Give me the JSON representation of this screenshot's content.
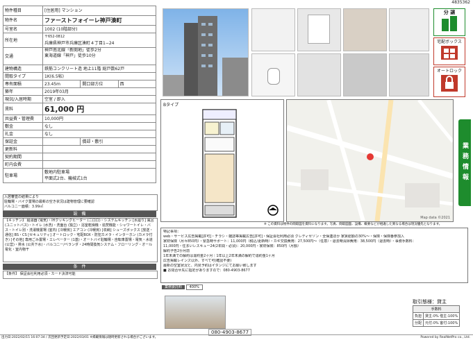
{
  "doc_id": "4835362",
  "spec": {
    "type_label": "物件種目",
    "type_value": "[住居用] マンション",
    "name_label": "物件名",
    "name_value": "ファーストフォイーレ神戸湊町",
    "room_label": "号室名",
    "room_value": "1002 (10階部分)",
    "address_label": "所在地",
    "postal": "〒652-0812",
    "address_value": "兵庫県神戸市兵庫区湊町４丁目1−24",
    "access_label": "交通",
    "access_1": "神戸南北線「新開地」徒歩2分",
    "access_2": "東海道線「神戸」徒歩10分",
    "structure_label": "建物構造",
    "structure_value": "鉄筋コンクリート造 地上11階 総戸数62戸",
    "layout_label": "間取タイプ",
    "layout_value": "1K(6.5帖)",
    "area_label": "専有面積",
    "area_value": "23.45m",
    "window_label": "開口部方位",
    "window_value": "西",
    "built_label": "築年",
    "built_value": "2019年03月",
    "status_label": "現況/入居時期",
    "status_value": "空室 / 即入",
    "rent_label": "賃料",
    "rent_value": "61,000 円",
    "common_label": "共益費・管理費",
    "common_value": "10,000円",
    "deposit_label": "敷金",
    "deposit_value": "なし",
    "key_label": "礼金",
    "key_value": "なし",
    "guarantee_label": "保証金",
    "guarantee_value": "償却・敷引",
    "renewal_label": "更新料",
    "contract_label": "契約期間",
    "assoc_label": "町内会費",
    "parking_label": "駐車場",
    "parking_1": "敷地内駐車場",
    "parking_2": "平面式2台、機械式1台",
    "notes_1": "入居審査の結果により",
    "notes_2": "駐輪場・バイク置場の最新の空き状況は建物管理に要確認",
    "notes_3": "バルコニー面積：3.99㎡",
    "facility_head": "設　備",
    "facility_text": "【キッチン】 給湯器 (電気)・IHクッキングヒーター (二口口)・システムキッチン [水廻り] 風呂 (ユニットバス)・トイレ (水洗)・洗面台 (独立)・浴室乾燥機・追焚機能・シャワートイレ・バス・トイレ別・洗濯機置場 (室内) [冷暖房] エアコン (冷暖房) [収納] シューズボックス [放送・通信] BS・CS [セキュリティ] オートロック・宅配BOX・防犯カメラ・インターホン (カメラ付き) [その他] 専用ごみ置場・エレベーター (1基)・オートバイ駐輪場・自転車置場・電気・水道 (公営)・排水 (公共下水)・バルコニー/ベランダ・24時間換気システム・フローリング・オール電化・室内物干",
    "cond_head": "条　件",
    "cond_text": "【条件】 保証会社利用必須・カード決済可能"
  },
  "floorplan": {
    "type_label": "Bタイプ"
  },
  "map": {
    "footer": "Map data ©2021"
  },
  "caption": "※ この資料は物件の間取図を資料になります。写真、間取図面、設備、概要などが相違した異なる場合は現況優先となります。",
  "remarks": {
    "title": "特記事項：",
    "lines": [
      "web・サービス広告掲載[許可]・チラシ・雑誌等掲載広告[許可]・保証会社利用必須 クレディセゾン・全保連ほか 家賃総額の30%〜・保険・保険番参加入",
      "家財保険（月々850円）・緊急時サポート：11,000円（税込/更新時）・カギ交換費用：27,500円〜（任意）・退去時清掃費用：38,500円（退去時）・事務手数料：",
      "11,000円・住まいレスキュー24(2年間・必須)：20,000円・家財保険：850円（月額）",
      "解約予告2か月前",
      "1年未満での解約は違約金2ヶ月｜1年以上2年未満の解約で違約金1ヶ月",
      "広告掲載レインズ以外、すべて可(確認不要)",
      "最新の空室状況と、内見予約はイタンジにてお願い致します",
      "■ お問合せ先に指定がありますので：080-4903-8677"
    ],
    "fee_label": "業務委託料",
    "fee_value": "400%"
  },
  "phone": "080-4903-8677",
  "transaction": {
    "label": "取引態様：貸主",
    "fee_head": "手数料",
    "row1_label": "負担",
    "row1_value": "貸主:0% 借主:100%",
    "row2_label": "分配",
    "row2_value": "元付:0% 客付:100%"
  },
  "badges": {
    "bunjo": "分 譲",
    "delivery": "宅配ボックス",
    "autolock": "オートロック"
  },
  "side_tab": "業務情報",
  "footer_left": "出力日:2022/02/15 16:07:34 / 次回更新予定日:2022/03/01 ※掲載情報は随時更新される場合がございます。",
  "footer_right": "Powered by RealNetPro co., Ltd."
}
